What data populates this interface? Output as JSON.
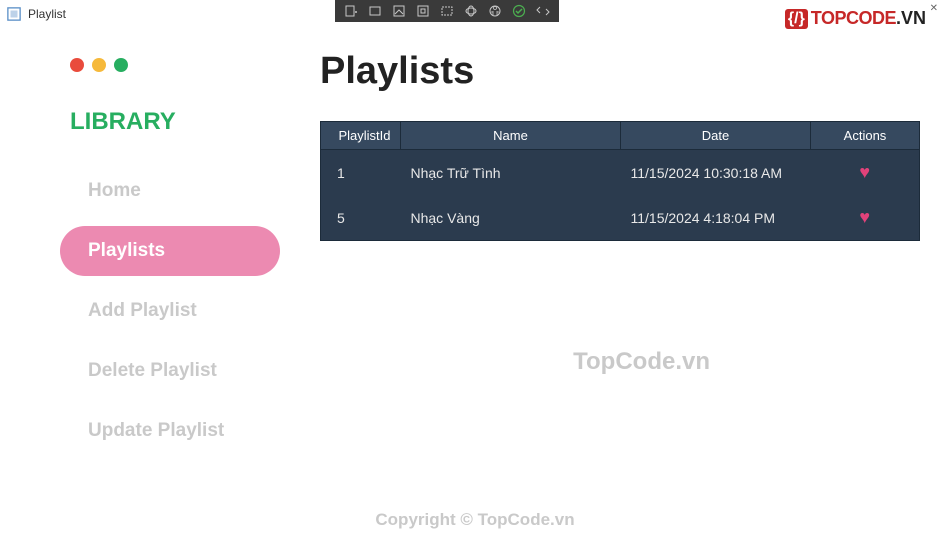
{
  "window": {
    "title": "Playlist"
  },
  "brand": {
    "braces": "{/}",
    "text": "TOPCODE",
    "suffix": ".VN"
  },
  "sidebar": {
    "header": "LIBRARY",
    "items": [
      {
        "label": "Home",
        "active": false
      },
      {
        "label": "Playlists",
        "active": true
      },
      {
        "label": "Add Playlist",
        "active": false
      },
      {
        "label": "Delete Playlist",
        "active": false
      },
      {
        "label": "Update Playlist",
        "active": false
      }
    ]
  },
  "page": {
    "title": "Playlists",
    "table": {
      "columns": {
        "id": "PlaylistId",
        "name": "Name",
        "date": "Date",
        "actions": "Actions"
      },
      "rows": [
        {
          "id": "1",
          "name": "Nhạc Trữ Tình",
          "date": "11/15/2024 10:30:18 AM"
        },
        {
          "id": "5",
          "name": "Nhạc Vàng",
          "date": "11/15/2024 4:18:04 PM"
        }
      ]
    }
  },
  "watermark": {
    "center": "TopCode.vn",
    "bottom": "Copyright © TopCode.vn"
  }
}
